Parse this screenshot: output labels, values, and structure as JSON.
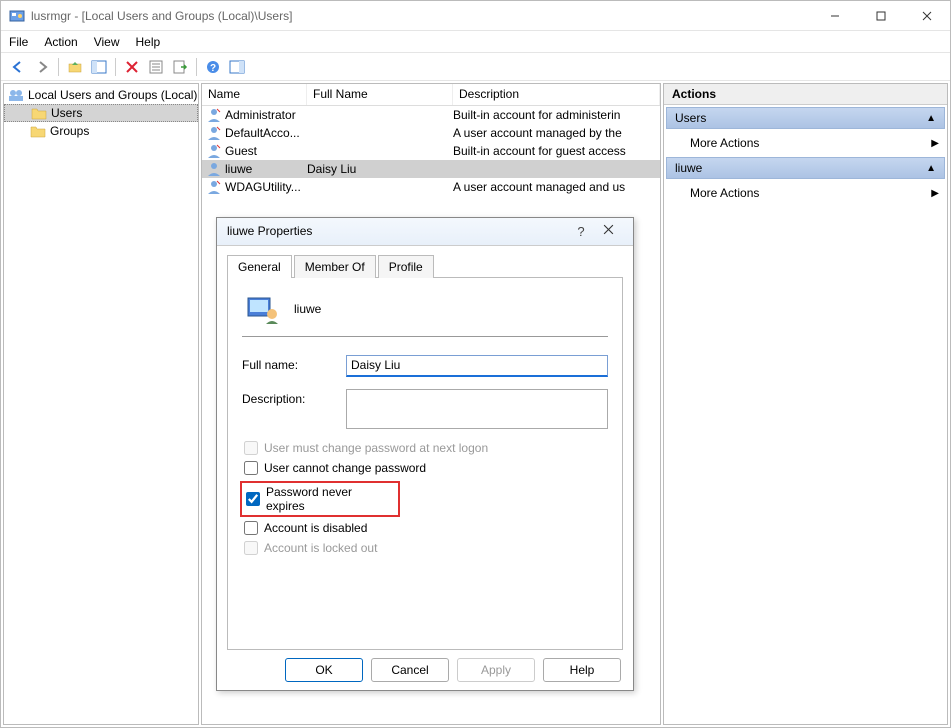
{
  "window": {
    "title": "lusrmgr - [Local Users and Groups (Local)\\Users]"
  },
  "menu": {
    "file": "File",
    "action": "Action",
    "view": "View",
    "help": "Help"
  },
  "tree": {
    "root": "Local Users and Groups (Local)",
    "users": "Users",
    "groups": "Groups"
  },
  "list": {
    "headers": {
      "name": "Name",
      "fullname": "Full Name",
      "description": "Description"
    },
    "rows": [
      {
        "name": "Administrator",
        "fullname": "",
        "description": "Built-in account for administerin"
      },
      {
        "name": "DefaultAcco...",
        "fullname": "",
        "description": "A user account managed by the"
      },
      {
        "name": "Guest",
        "fullname": "",
        "description": "Built-in account for guest access"
      },
      {
        "name": "liuwe",
        "fullname": "Daisy Liu",
        "description": ""
      },
      {
        "name": "WDAGUtility...",
        "fullname": "",
        "description": "A user account managed and us"
      }
    ]
  },
  "actions": {
    "header": "Actions",
    "section1": "Users",
    "item1": "More Actions",
    "section2": "liuwe",
    "item2": "More Actions"
  },
  "dialog": {
    "title": "liuwe Properties",
    "tabs": {
      "general": "General",
      "member": "Member Of",
      "profile": "Profile"
    },
    "username": "liuwe",
    "labels": {
      "fullname": "Full name:",
      "description": "Description:"
    },
    "fullname_value": "Daisy Liu",
    "description_value": "",
    "checks": {
      "mustchange": "User must change password at next logon",
      "cannotchange": "User cannot change password",
      "neverexpires": "Password never expires",
      "disabled": "Account is disabled",
      "locked": "Account is locked out"
    },
    "buttons": {
      "ok": "OK",
      "cancel": "Cancel",
      "apply": "Apply",
      "help": "Help"
    }
  }
}
